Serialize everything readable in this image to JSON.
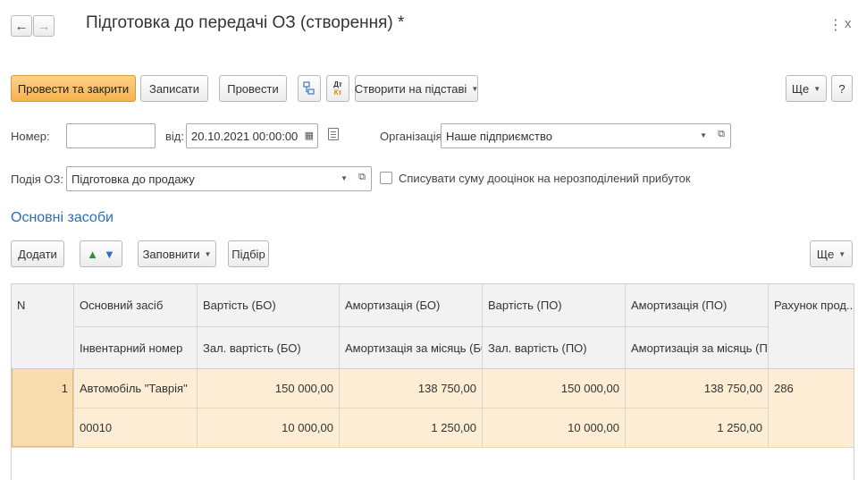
{
  "window": {
    "title": "Підготовка до передачі ОЗ (створення) *",
    "more_dots": "⋮",
    "close": "x"
  },
  "toolbar": {
    "post_and_close": "Провести та закрити",
    "save": "Записати",
    "post": "Провести",
    "dt_kt_top": "Дт",
    "dt_kt_bottom": "Кт",
    "create_based_on": "Створити на підставі",
    "more": "Ще",
    "help": "?"
  },
  "form": {
    "number_label": "Номер:",
    "number_value": "",
    "from_label": "від:",
    "date_value": "20.10.2021 00:00:00",
    "org_label": "Організація:",
    "org_value": "Наше підприємство",
    "event_label": "Подія ОЗ:",
    "event_value": "Підготовка до продажу",
    "writeoff_label": "Списувати суму дооцінок на нерозподілений прибуток"
  },
  "section": {
    "title": "Основні засоби",
    "add": "Додати",
    "fill": "Заповнити",
    "pick": "Підбір",
    "more": "Ще"
  },
  "table": {
    "headers": {
      "n": "N",
      "asset": "Основний засіб",
      "inventory": "Інвентарний номер",
      "cost_bo": "Вартість (БО)",
      "residual_bo": "Зал. вартість (БО)",
      "amort_bo": "Амортизація (БО)",
      "amort_month_bo": "Амортизація за місяць (БО)",
      "cost_po": "Вартість (ПО)",
      "residual_po": "Зал. вартість (ПО)",
      "amort_po": "Амортизація (ПО)",
      "amort_month_po": "Амортизація за місяць (ПО)",
      "account": "Рахунок прод..."
    },
    "rows": [
      {
        "n": "1",
        "asset": "Автомобіль \"Таврія\"",
        "inventory": "00010",
        "cost_bo": "150 000,00",
        "residual_bo": "10 000,00",
        "amort_bo": "138 750,00",
        "amort_month_bo": "1 250,00",
        "cost_po": "150 000,00",
        "residual_po": "10 000,00",
        "amort_po": "138 750,00",
        "amort_month_po": "1 250,00",
        "account": "286"
      }
    ]
  }
}
